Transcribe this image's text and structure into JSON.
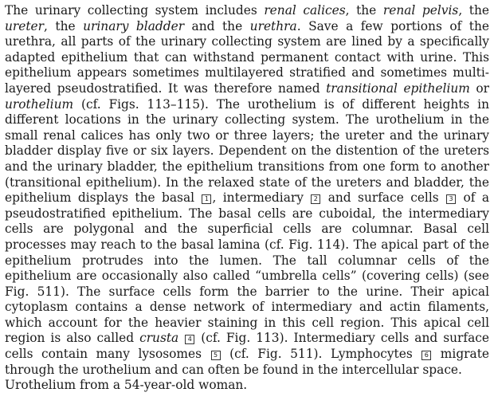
{
  "body": {
    "t1": "The urinary collecting system includes ",
    "e1": "renal calices",
    "t2": ", the ",
    "e2": "renal pelvis",
    "t3": ", the ",
    "e3": "ureter",
    "t4": ", the ",
    "e4": "urinary bladder",
    "t5": " and the ",
    "e5": "urethra",
    "t6": ". Save a few portions of the urethra, all parts of the urinary collecting system are lined by a specifically adapted epithelium that can withstand permanent contact with urine. This epithe­lium appears sometimes multilayered stratified and sometimes multi­layered pseudostratified. It was therefore named ",
    "e6": "transitional epithelium",
    "t7": " or ",
    "e7": "urothelium",
    "t8": " (cf. Figs. 113–115). The urothelium is of different heights in differ­ent locations in the urinary collecting system. The urothelium in the small renal calices has only two or three layers; the ureter and the urinary bladder display five or six layers. Dependent on the distention of the ureters and the urinary bladder, the epithelium transitions from one form to another (transi­tional epithelium). In the relaxed state of the ureters and bladder, the epithe­lium displays the basal ",
    "n1": "1",
    "t9": ", intermediary ",
    "n2": "2",
    "t10": " and surface cells ",
    "n3": "3",
    "t11": " of a pseudo­stratified epithelium. The basal cells are cuboidal, the intermediary cells are polygonal and the superficial cells are columnar. Basal cell processes may reach to the basal lamina (cf. Fig. 114). The apical part of the epithelium pro­trudes into the lumen. The tall columnar cells of the epithelium are occa­sionally also called “umbrella cells” (covering cells) (see Fig. 511). The surface cells form the barrier to the urine. Their apical cytoplasm contains a dense network of intermediary and actin filaments, which account for the heavier staining in this cell region. This apical cell region is also called ",
    "e8": "crusta",
    "t12": " ",
    "n4": "4",
    "t13": " (cf. Fig. 113). Intermediary cells and surface cells contain many lysosomes ",
    "n5": "5",
    "t14": " (cf. Fig. 511). Lymphocytes ",
    "n6": "6",
    "t15": " migrate through the urothelium and can often be found in the intercellular space."
  },
  "caption": "Urothelium from a 54-year-old woman."
}
